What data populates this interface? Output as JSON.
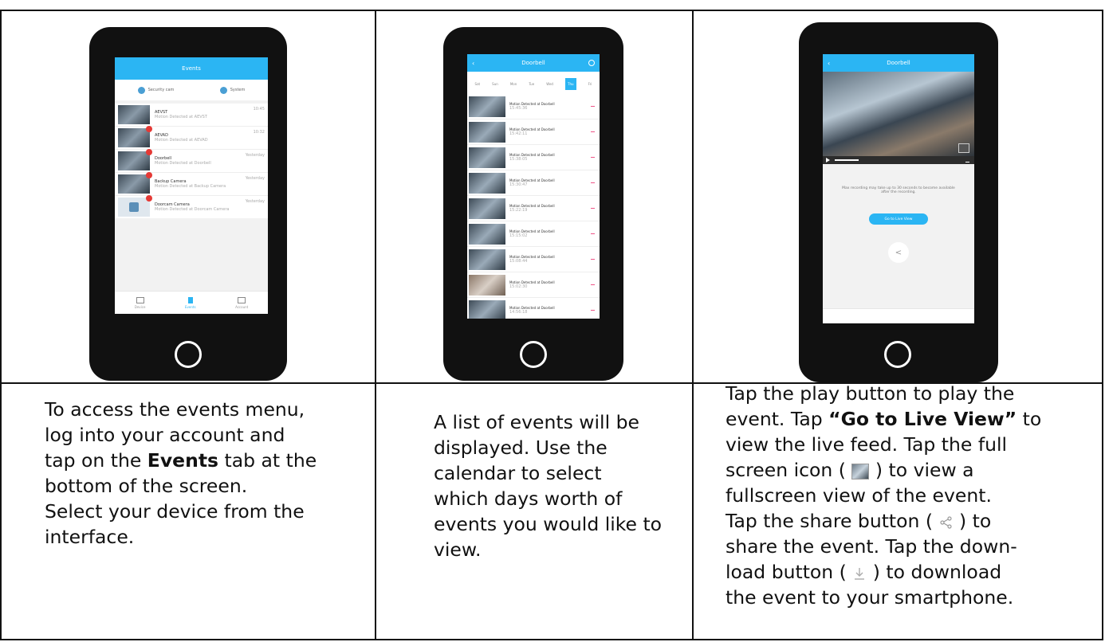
{
  "panel1": {
    "phone1": {
      "title": "Events",
      "filters": [
        "Security cam",
        "System"
      ],
      "devices": [
        {
          "name": "AEVST",
          "desc": "Motion Detected at AEVST",
          "time": "10:45"
        },
        {
          "name": "AEVAD",
          "desc": "Motion Detected at AEVAD",
          "time": "10:32"
        },
        {
          "name": "Doorbell",
          "desc": "Motion Detected at Doorbell",
          "time": "Yesterday"
        },
        {
          "name": "Backup Camera",
          "desc": "Motion Detected at Backup Camera",
          "time": "Yesterday"
        },
        {
          "name": "Doorcam Camera",
          "desc": "Motion Detected at Doorcam Camera",
          "time": "Yesterday"
        }
      ],
      "tabs": [
        "Device",
        "Events",
        "Account"
      ]
    },
    "text_line1": "To access the events menu,",
    "text_line2": "log into your account and",
    "text_line3_pre": "tap on the ",
    "text_line3_bold": "Events",
    "text_line3_post": " tab at the",
    "text_line4": "bottom of the screen.",
    "text_line5": "Select your device from the",
    "text_line6": "interface."
  },
  "panel2": {
    "phone2": {
      "title": "Doorbell",
      "days": [
        "Sat",
        "Sun",
        "Mon",
        "Tue",
        "Wed",
        "Thu",
        "Fri"
      ],
      "event_title": "Motion Detected at Doorbell",
      "times": [
        "15:45:36",
        "15:42:11",
        "15:38:05",
        "15:30:47",
        "15:22:19",
        "15:15:02",
        "15:08:44",
        "15:02:30",
        "14:56:18"
      ]
    },
    "text_line1": "A list of events will be",
    "text_line2": "displayed. Use the",
    "text_line3": "calendar to select",
    "text_line4": "which days worth of",
    "text_line5": "events you would like to",
    "text_line6": "view."
  },
  "panel3": {
    "phone3": {
      "title": "Doorbell",
      "message": "Max recording may take up to 30 seconds to become available after the recording.",
      "live_button": "Go to Live View"
    },
    "line1": "Tap the play button to play the",
    "line2_pre": "event. Tap ",
    "line2_bold": "“Go to Live View”",
    "line2_post": " to",
    "line3": "view the live feed. Tap the full",
    "line4_pre": "screen icon ( ",
    "line4_post": " ) to view a",
    "line5": "fullscreen view of the event.",
    "line6_pre": "Tap the share button ( ",
    "line6_post": " ) to",
    "line7": "share the event. Tap the down-",
    "line8_pre": "load button ( ",
    "line8_post": " ) to download",
    "line9": "the event to your smartphone."
  }
}
